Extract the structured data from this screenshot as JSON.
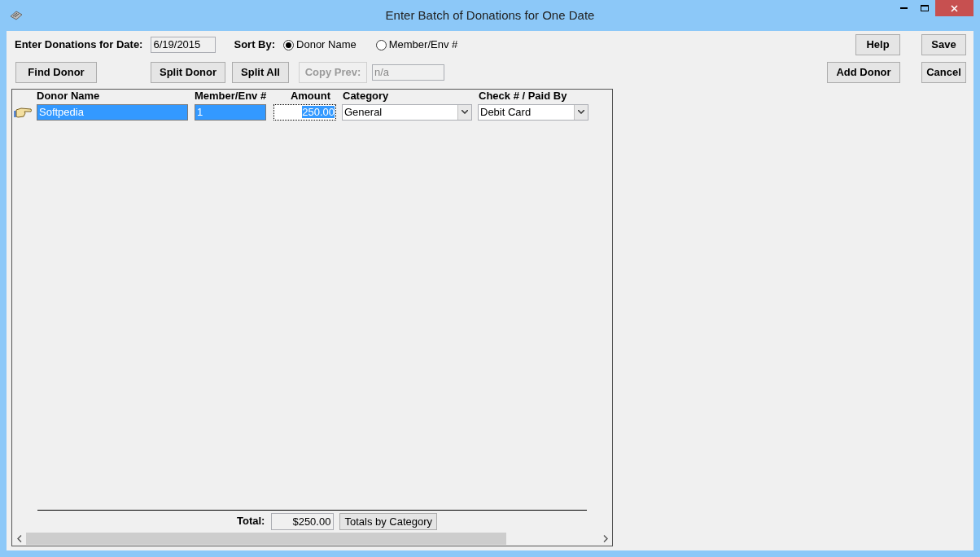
{
  "window": {
    "title": "Enter Batch of Donations for One Date"
  },
  "date": {
    "label": "Enter Donations for Date:",
    "value": "6/19/2015"
  },
  "sort": {
    "label": "Sort By:",
    "options": [
      {
        "label": "Donor Name",
        "selected": true
      },
      {
        "label": "Member/Env #",
        "selected": false
      }
    ]
  },
  "buttons_left": [
    {
      "label": "Find Donor",
      "disabled": false
    },
    {
      "label": "Split Donor",
      "disabled": false
    },
    {
      "label": "Split All",
      "disabled": false
    },
    {
      "label": "Copy Prev:",
      "disabled": true
    }
  ],
  "copy_prev_value": "n/a",
  "buttons_right": [
    {
      "label": "Help"
    },
    {
      "label": "Save"
    },
    {
      "label": "Add Donor"
    },
    {
      "label": "Cancel"
    }
  ],
  "table": {
    "columns": [
      "Donor Name",
      "Member/Env #",
      "Amount",
      "Category",
      "Check # / Paid By"
    ],
    "rows": [
      {
        "donor": "Softpedia",
        "member": "1",
        "amount": "250.00",
        "category": "General",
        "paid_by": "Debit Card",
        "selected": true
      }
    ]
  },
  "total": {
    "label": "Total:",
    "value": "$250.00",
    "button": "Totals by Category"
  }
}
